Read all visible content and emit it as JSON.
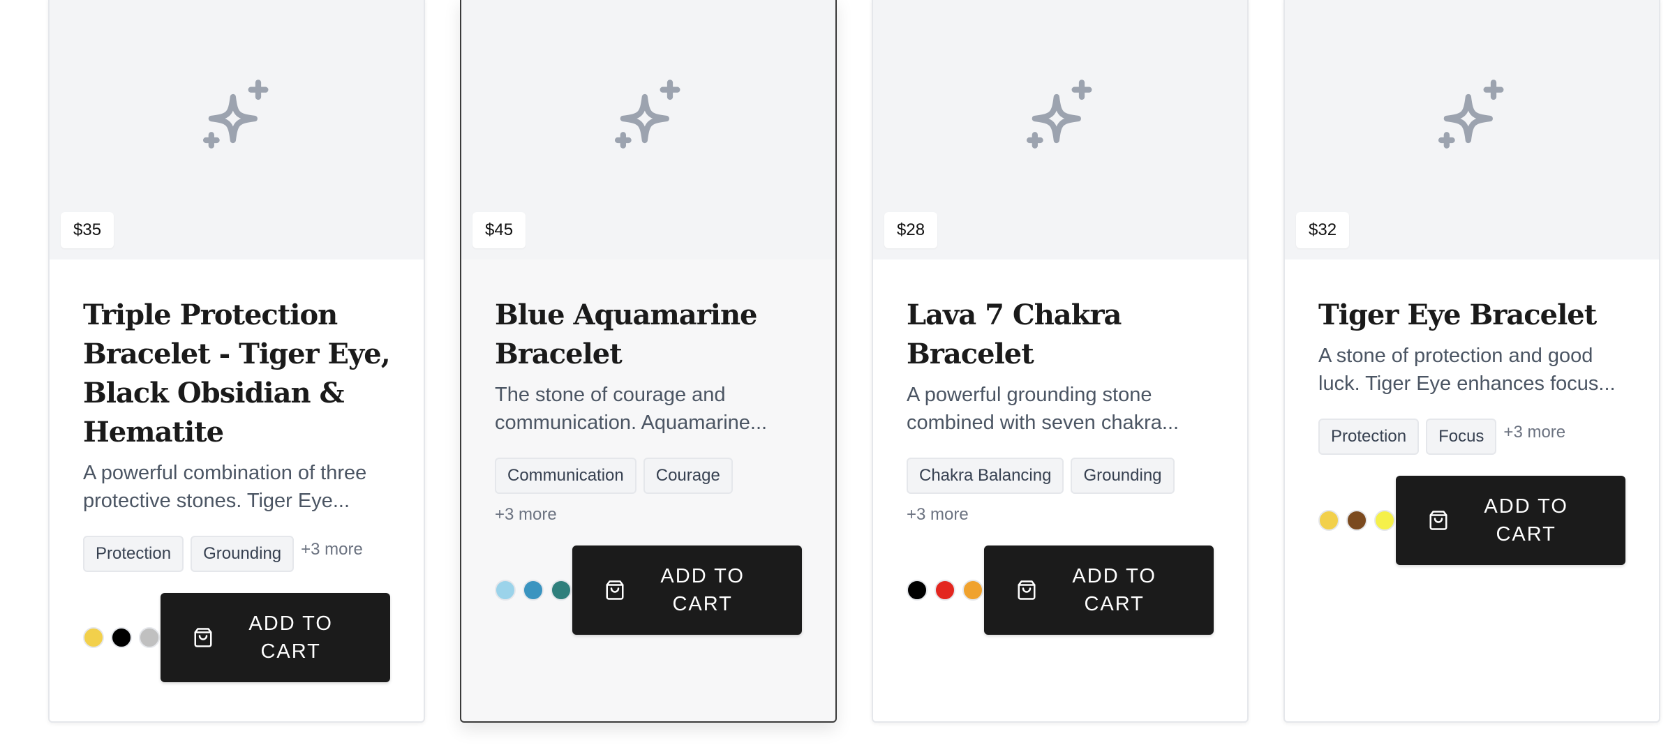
{
  "products": [
    {
      "price": "$35",
      "title": "Triple Protection Bracelet - Tiger Eye, Black Obsidian & Hematite",
      "description": "A powerful combination of three protective stones. Tiger Eye...",
      "tags": [
        "Protection",
        "Grounding"
      ],
      "more": "+3 more",
      "swatches": [
        "#f2d04b",
        "#000000",
        "#c0c0c0"
      ],
      "cta": "ADD TO CART"
    },
    {
      "price": "$45",
      "title": "Blue Aquamarine Bracelet",
      "description": "The stone of courage and communication. Aquamarine...",
      "tags": [
        "Communication",
        "Courage"
      ],
      "more": "+3 more",
      "swatches": [
        "#9bd3ea",
        "#3a94c0",
        "#2f7f7c"
      ],
      "cta": "ADD TO CART"
    },
    {
      "price": "$28",
      "title": "Lava 7 Chakra Bracelet",
      "description": "A powerful grounding stone combined with seven chakra...",
      "tags": [
        "Chakra Balancing",
        "Grounding"
      ],
      "more": "+3 more",
      "swatches": [
        "#000000",
        "#e3261f",
        "#f0a22e"
      ],
      "cta": "ADD TO CART"
    },
    {
      "price": "$32",
      "title": "Tiger Eye Bracelet",
      "description": "A stone of protection and good luck. Tiger Eye enhances focus...",
      "tags": [
        "Protection",
        "Focus"
      ],
      "more": "+3 more",
      "swatches": [
        "#f2d04b",
        "#7b4a1f",
        "#f5f04a"
      ],
      "cta": "ADD TO CART"
    }
  ],
  "icons": {
    "image_placeholder": "sparkles-icon",
    "cart": "shopping-bag-icon"
  },
  "colors": {
    "button_bg": "#1b1b1b",
    "placeholder_icon": "#9ca3af",
    "card_bg": "#ffffff"
  }
}
